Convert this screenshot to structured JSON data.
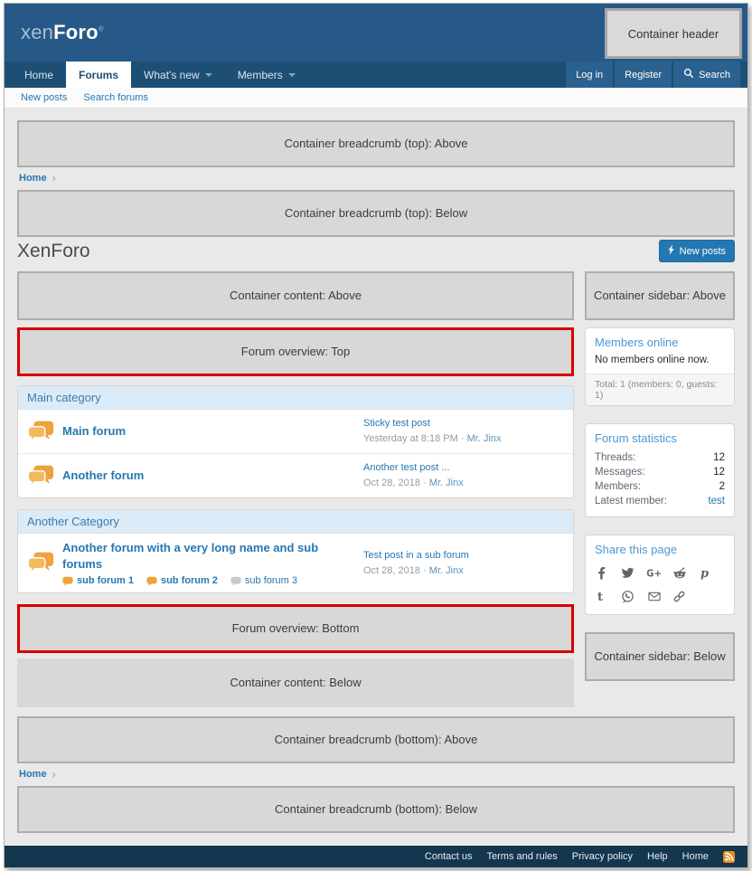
{
  "separators": {
    "breadcrumb": "›",
    "meta": "·"
  },
  "header": {
    "logo_xen": "xen",
    "logo_foro": "Foro",
    "logo_reg": "®",
    "container_box": "Container header"
  },
  "nav": {
    "items": [
      {
        "label": "Home",
        "selected": false,
        "has_menu": false
      },
      {
        "label": "Forums",
        "selected": true,
        "has_menu": false
      },
      {
        "label": "What's new",
        "selected": false,
        "has_menu": true
      },
      {
        "label": "Members",
        "selected": false,
        "has_menu": true
      }
    ],
    "login": "Log in",
    "register": "Register",
    "search": "Search"
  },
  "subnav": {
    "items": [
      "New posts",
      "Search forums"
    ]
  },
  "breadcrumb_top": {
    "above_box": "Container breadcrumb (top): Above",
    "home": "Home",
    "below_box": "Container breadcrumb (top): Below"
  },
  "page": {
    "title": "XenForo",
    "new_posts_button": "New posts"
  },
  "content": {
    "above_box": "Container content: Above",
    "overview_top_box": "Forum overview: Top",
    "overview_bottom_box": "Forum overview: Bottom",
    "below_box": "Container content: Below"
  },
  "categories": [
    {
      "title": "Main category",
      "forums": [
        {
          "name": "Main forum",
          "last_post_title": "Sticky test post",
          "last_post_date": "Yesterday at 8:18 PM",
          "last_post_user": "Mr. Jinx",
          "subforums": []
        },
        {
          "name": "Another forum",
          "last_post_title": "Another test post ...",
          "last_post_date": "Oct 28, 2018",
          "last_post_user": "Mr. Jinx",
          "subforums": []
        }
      ]
    },
    {
      "title": "Another Category",
      "forums": [
        {
          "name": "Another forum with a very long name and sub forums",
          "last_post_title": "Test post in a sub forum",
          "last_post_date": "Oct 28, 2018",
          "last_post_user": "Mr. Jinx",
          "subforums": [
            {
              "name": "sub forum 1",
              "unread": true
            },
            {
              "name": "sub forum 2",
              "unread": true
            },
            {
              "name": "sub forum 3",
              "unread": false
            }
          ]
        }
      ]
    }
  ],
  "sidebar": {
    "above_box": "Container sidebar: Above",
    "members_online": {
      "title": "Members online",
      "empty_text": "No members online now.",
      "total_text": "Total: 1 (members: 0, guests: 1)"
    },
    "forum_statistics": {
      "title": "Forum statistics",
      "rows": [
        {
          "label": "Threads:",
          "value": "12",
          "is_link": false
        },
        {
          "label": "Messages:",
          "value": "12",
          "is_link": false
        },
        {
          "label": "Members:",
          "value": "2",
          "is_link": false
        },
        {
          "label": "Latest member:",
          "value": "test",
          "is_link": true
        }
      ]
    },
    "share": {
      "title": "Share this page",
      "icons": [
        "facebook",
        "twitter",
        "google-plus",
        "reddit",
        "pinterest",
        "tumblr",
        "whatsapp",
        "email",
        "link"
      ]
    },
    "below_box": "Container sidebar: Below"
  },
  "breadcrumb_bottom": {
    "above_box": "Container breadcrumb (bottom): Above",
    "home": "Home",
    "below_box": "Container breadcrumb (bottom): Below"
  },
  "footer": {
    "links": [
      "Contact us",
      "Terms and rules",
      "Privacy policy",
      "Help",
      "Home"
    ]
  },
  "colors": {
    "header_blue": "#265987",
    "nav_blue": "#1d4e74",
    "accent_blue": "#2577b1",
    "footer_navy": "#14364f",
    "placeholder_fill": "#d8d8d8",
    "placeholder_border": "#adadad",
    "debug_red": "#d60000",
    "unread_amber": "#f0a23c",
    "rss_orange": "#e78b20"
  }
}
